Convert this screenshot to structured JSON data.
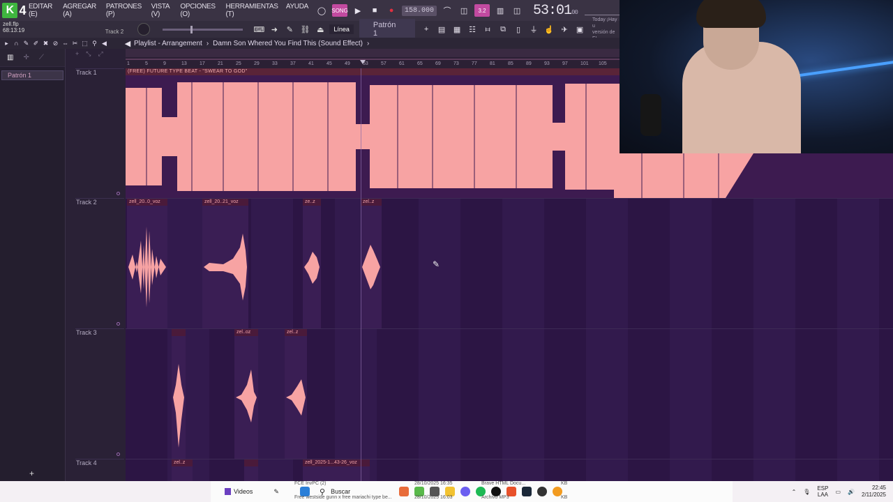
{
  "app": {
    "logo_num": "4",
    "menus": [
      "EDITAR (E)",
      "AGREGAR (A)",
      "PATRONES (P)",
      "VISTA (V)",
      "OPCIONES (O)",
      "HERRAMIENTAS (T)",
      "AYUDA"
    ],
    "tempo": "158.000",
    "pattern_mode_label": "3.2",
    "time_main": "53:01",
    "time_sub": "00",
    "time_small": "B:S:T"
  },
  "project": {
    "file": "zell.flp",
    "elapsed": "68:13:19",
    "track_focus": "Track 2"
  },
  "toolbar": {
    "snap": "Línea",
    "pattern": "Patrón 1",
    "news_line1": "Today  ¡Hay u",
    "news_line2": "versión de FL"
  },
  "playlist": {
    "title": "Playlist - Arrangement",
    "song": "Damn Son Whered You Find This (Sound Effect)",
    "ruler_ticks": [
      "1",
      "5",
      "9",
      "13",
      "17",
      "21",
      "25",
      "29",
      "33",
      "37",
      "41",
      "45",
      "49",
      "53",
      "57",
      "61",
      "65",
      "69",
      "73",
      "77",
      "81",
      "85",
      "89",
      "93",
      "97",
      "101",
      "105"
    ]
  },
  "picker": {
    "items": [
      "Patrón 1"
    ]
  },
  "tracks": [
    {
      "name": "Track 1"
    },
    {
      "name": "Track 2"
    },
    {
      "name": "Track 3"
    },
    {
      "name": "Track 4"
    }
  ],
  "clips": {
    "t1_beat": "(FREE) FUTURE TYPE BEAT - \"SWEAR TO GOD\"",
    "t2_a": "zell_20..0_voz",
    "t2_b": "zell_20..21_voz",
    "t2_c": "ze..z",
    "t2_d": "zel..z",
    "t3_a": "",
    "t3_b": "zel..oz",
    "t3_c": "zel..z",
    "t4_a": "zel..z",
    "t4_b": "",
    "t4_c": "zell_2025-1...43-26_voz"
  },
  "taskbar": {
    "videos": "Videos",
    "search": "Buscar",
    "tip1": "FCE InvPC (2)",
    "tip2": "Free westside gunn x free mariachi type be...",
    "tip3": "28/10/2025 16:35",
    "tip4": "28/10/2025 16:03",
    "tip5": "Brave HTML Docu...",
    "tip6": "Archivo MP3",
    "tip7": "KB",
    "tip8": "KB",
    "lang1": "ESP",
    "lang2": "LAA",
    "clock_time": "22:45",
    "clock_date": "2/11/2025"
  },
  "colors": {
    "accent_wave": "#f7a3a3",
    "grid_bg": "#2c1544",
    "clip_header": "#4a1a3a"
  }
}
